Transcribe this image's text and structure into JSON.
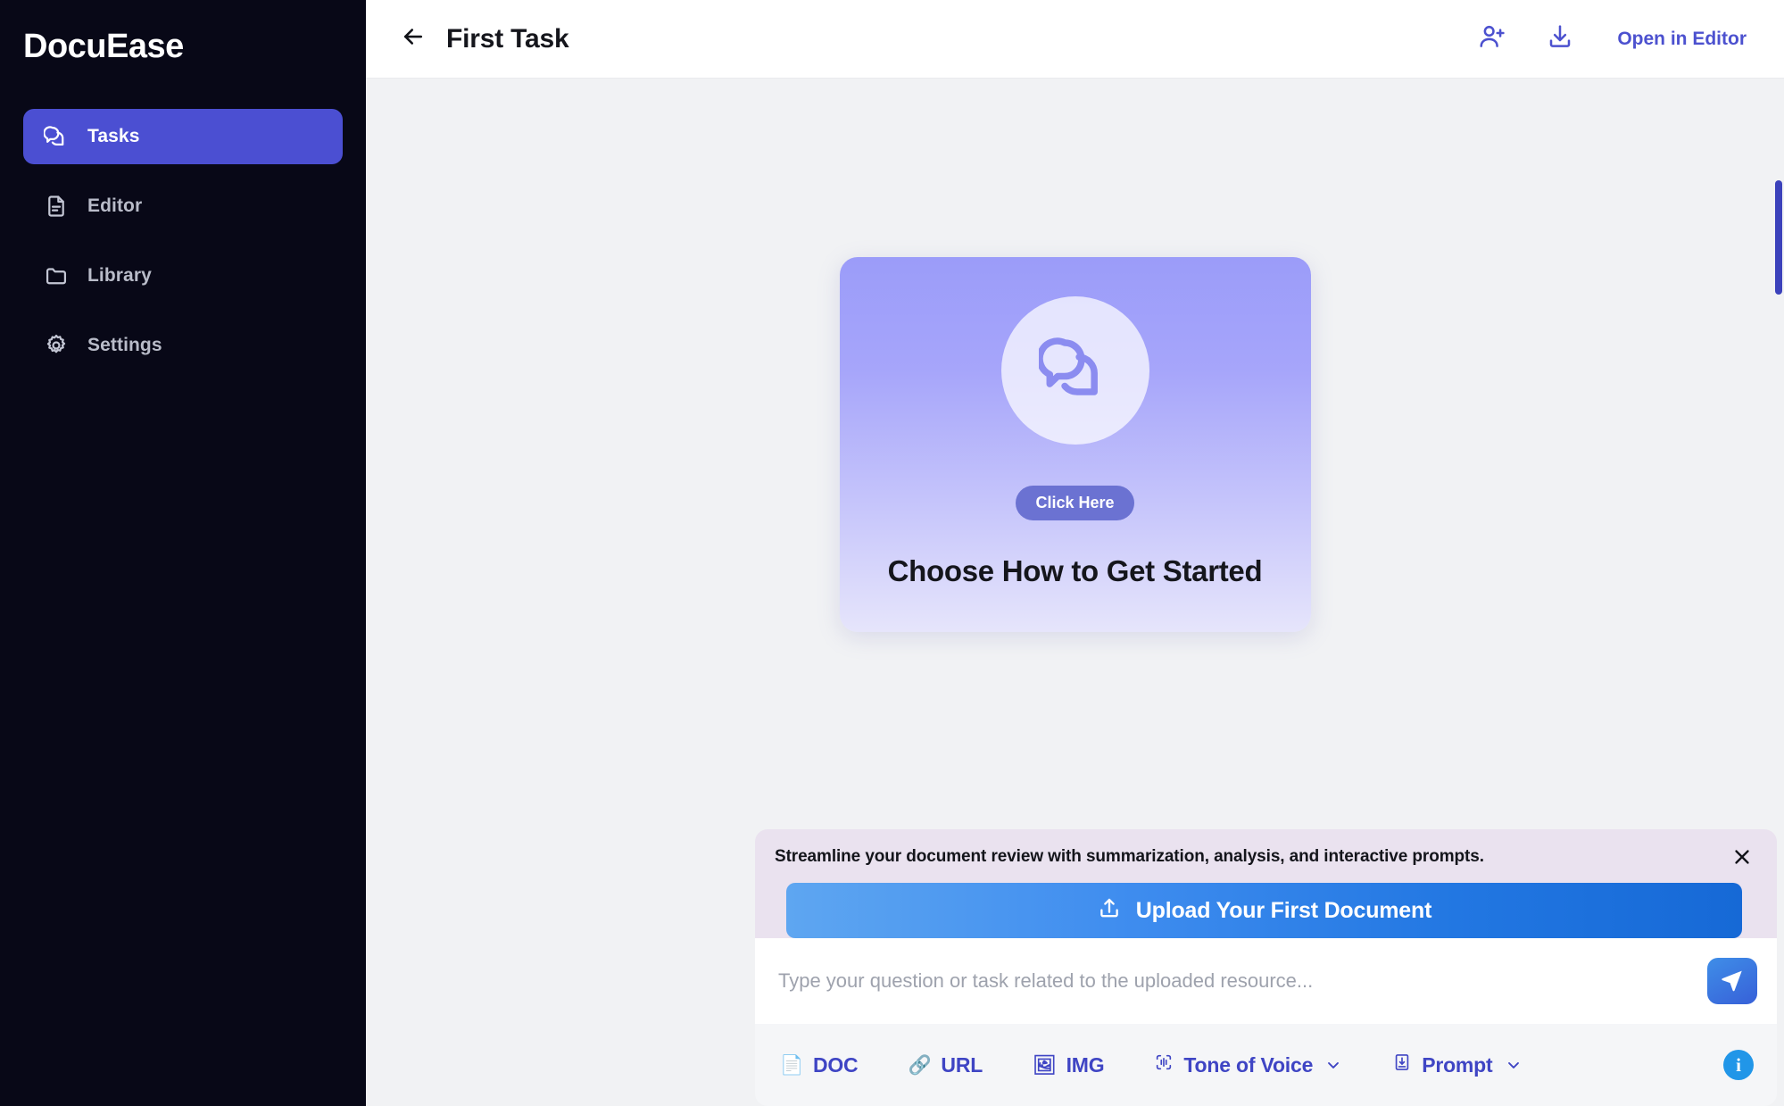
{
  "brand": {
    "name": "DocuEase"
  },
  "sidebar": {
    "items": [
      {
        "label": "Tasks",
        "icon": "chat-bubbles-icon",
        "active": true
      },
      {
        "label": "Editor",
        "icon": "document-icon",
        "active": false
      },
      {
        "label": "Library",
        "icon": "folder-icon",
        "active": false
      },
      {
        "label": "Settings",
        "icon": "gear-icon",
        "active": false
      }
    ]
  },
  "topbar": {
    "back_icon": "arrow-left-icon",
    "title": "First Task",
    "add_user_icon": "user-plus-icon",
    "download_icon": "download-icon",
    "open_in_editor": "Open in Editor"
  },
  "canvas": {
    "card": {
      "icon": "chat-bubbles-icon",
      "badge": "Click Here",
      "title": "Choose How to Get Started"
    }
  },
  "composer": {
    "promo": {
      "text": "Streamline your document review with summarization, analysis, and interactive prompts.",
      "close_icon": "close-icon"
    },
    "upload_button": {
      "label": "Upload Your First Document",
      "icon": "upload-icon"
    },
    "input": {
      "placeholder": "Type your question or task related to the uploaded resource...",
      "value": ""
    },
    "send_button": {
      "icon": "send-icon"
    },
    "tools": [
      {
        "label": "DOC",
        "icon": "doc-file-icon",
        "glyph": "📄",
        "chevron": false
      },
      {
        "label": "URL",
        "icon": "link-icon",
        "glyph": "🔗",
        "chevron": false
      },
      {
        "label": "IMG",
        "icon": "image-icon",
        "glyph": "🖼",
        "chevron": false
      },
      {
        "label": "Tone of Voice",
        "icon": "waveform-icon",
        "glyph": "",
        "chevron": true
      },
      {
        "label": "Prompt",
        "icon": "prompt-icon",
        "glyph": "",
        "chevron": true
      }
    ],
    "info_button": {
      "label": "i",
      "icon": "info-icon"
    }
  },
  "colors": {
    "sidebar_bg": "#080817",
    "accent_indigo": "#4b4fd2",
    "link_indigo": "#4c51cf",
    "promo_bg": "#eae2ef",
    "upload_gradient_from": "#5ea6f1",
    "upload_gradient_to": "#1669d6",
    "canvas_bg": "#f1f2f4",
    "card_gradient_from": "#9b9cf9",
    "card_gradient_to": "#e6e5fb",
    "badge_bg": "#6b72d2",
    "info_bg": "#2196e8",
    "scrollbar_thumb": "#3c42bb"
  }
}
